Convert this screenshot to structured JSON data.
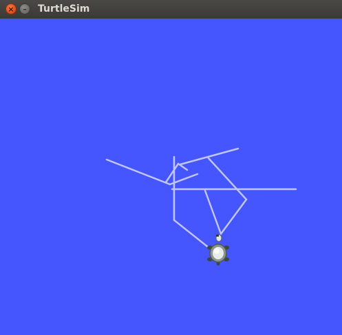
{
  "window": {
    "title": "TurtleSim",
    "close_glyph": "×",
    "minimize_glyph": "–"
  },
  "canvas": {
    "background_color": "#4556ff",
    "pen_color": "#c0c4ff"
  },
  "turtle": {
    "icon": "turtle-icon"
  }
}
